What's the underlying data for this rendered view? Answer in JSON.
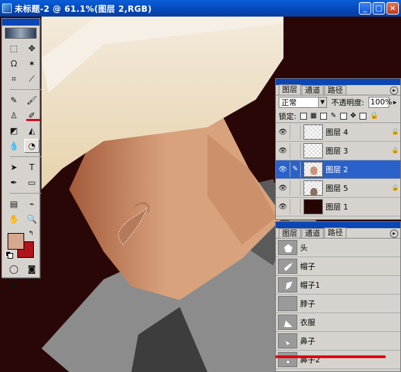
{
  "window": {
    "title": "未标题-2 @ 61.1%(图层 2,RGB)",
    "buttons": [
      "_",
      "□",
      "×"
    ]
  },
  "toolbox": {
    "tools": [
      "marquee-tool",
      "move-tool",
      "lasso-tool",
      "magic-wand-tool",
      "crop-tool",
      "slice-tool",
      "healing-brush-tool",
      "brush-tool",
      "clone-stamp-tool",
      "history-brush-tool",
      "eraser-tool",
      "gradient-tool",
      "blur-tool",
      "burn-tool",
      "path-selection-tool",
      "type-tool",
      "pen-tool",
      "rectangle-tool",
      "notes-tool",
      "eyedropper-tool",
      "hand-tool",
      "zoom-tool"
    ],
    "foreground_color": "#d6a88e",
    "background_color": "#b0141c"
  },
  "layers_panel": {
    "tabs": [
      "图层",
      "通道",
      "路径"
    ],
    "active_tab": 0,
    "blend_mode": "正常",
    "opacity_label": "不透明度:",
    "opacity_value": "100%",
    "lock_label": "锁定:",
    "layers": [
      {
        "name": "图层 4",
        "selected": false,
        "locked": true
      },
      {
        "name": "图层 3",
        "selected": false,
        "locked": true
      },
      {
        "name": "图层 2",
        "selected": true,
        "locked": false
      },
      {
        "name": "图层 5",
        "selected": false,
        "locked": true
      },
      {
        "name": "图层 1",
        "selected": false,
        "locked": false
      }
    ]
  },
  "paths_panel": {
    "tabs": [
      "图层",
      "通道",
      "路径"
    ],
    "active_tab": 2,
    "paths": [
      "头",
      "帽子",
      "帽子1",
      "脖子",
      "衣服",
      "鼻子",
      "鼻子2"
    ]
  },
  "colors": {
    "canvas_bg": "#2a0808",
    "skin": "#d8a27c",
    "hat": "#e8d7b4",
    "shirt": "#8f8f8f",
    "selection_accent": "#2a62c9",
    "highlight_red": "#e00012"
  }
}
